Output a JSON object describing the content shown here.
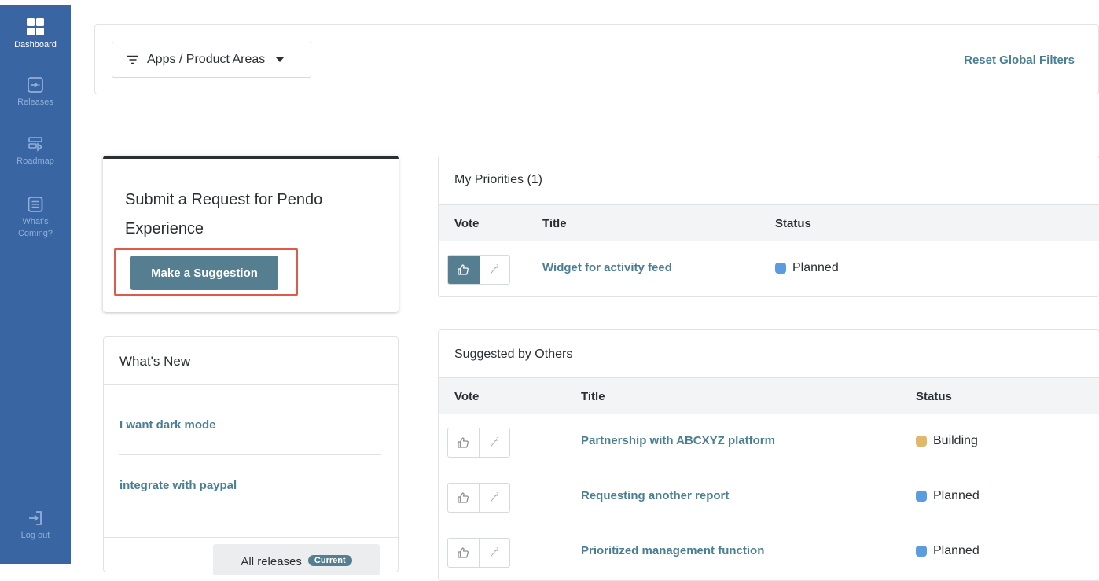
{
  "sidebar": {
    "items": [
      {
        "label": "Dashboard",
        "icon": "grid-icon"
      },
      {
        "label": "Releases",
        "icon": "release-icon"
      },
      {
        "label": "Roadmap",
        "icon": "roadmap-icon"
      },
      {
        "label": "What's Coming?",
        "icon": "list-icon"
      }
    ],
    "logout_label": "Log out"
  },
  "filters": {
    "apps_label": "Apps / Product Areas",
    "reset_label": "Reset Global Filters"
  },
  "submit_card": {
    "title": "Submit a Request for Pendo Experience",
    "button_label": "Make a Suggestion"
  },
  "whats_new": {
    "title": "What's New",
    "items": [
      "I want dark mode",
      "integrate with paypal"
    ],
    "all_releases_label": "All releases",
    "badge_label": "Current"
  },
  "my_priorities": {
    "title": "My Priorities (1)",
    "headers": {
      "vote": "Vote",
      "title": "Title",
      "status": "Status"
    },
    "rows": [
      {
        "title": "Widget for activity feed",
        "status": "Planned",
        "status_color": "#5b9be0",
        "voted": true
      }
    ]
  },
  "suggested": {
    "title": "Suggested by Others",
    "headers": {
      "vote": "Vote",
      "title": "Title",
      "status": "Status"
    },
    "rows": [
      {
        "title": "Partnership with ABCXYZ platform",
        "status": "Building",
        "status_color": "#e0b86a",
        "voted": false
      },
      {
        "title": "Requesting another report",
        "status": "Planned",
        "status_color": "#5b9be0",
        "voted": false
      },
      {
        "title": "Prioritized management function",
        "status": "Planned",
        "status_color": "#5b9be0",
        "voted": false
      }
    ]
  },
  "colors": {
    "sidebar_bg": "#3a65a3",
    "accent": "#557e91",
    "link": "#4a7f93",
    "highlight": "#e05a4a"
  }
}
